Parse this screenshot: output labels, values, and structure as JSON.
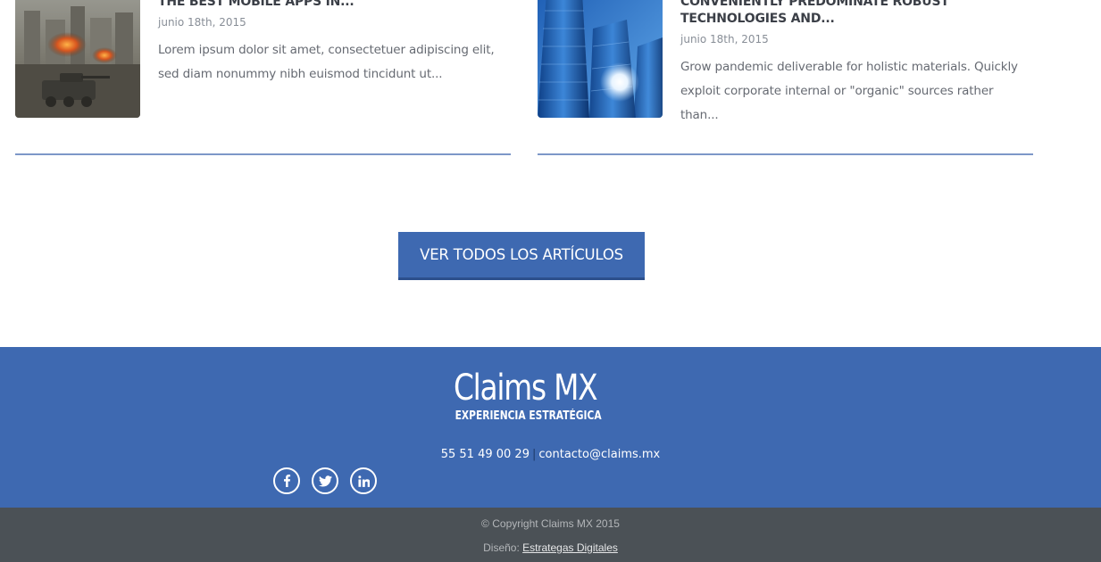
{
  "posts": [
    {
      "title": "THE BEST MOBILE APPS IN...",
      "date": "junio 18th, 2015",
      "excerpt": "Lorem ipsum dolor sit amet, consectetuer adipiscing elit, sed diam nonummy nibh euismod tincidunt ut..."
    },
    {
      "title": "CONVENIENTLY PREDOMINATE ROBUST TECHNOLOGIES AND...",
      "date": "junio 18th, 2015",
      "excerpt": "Grow pandemic deliverable for holistic materials. Quickly exploit corporate internal or \"organic\" sources rather than..."
    }
  ],
  "cta": {
    "label": "VER TODOS LOS ARTÍCULOS"
  },
  "footer": {
    "brand_name": "Claims MX",
    "brand_tagline": "EXPERIENCIA ESTRATÉGICA",
    "phone": "55 51 49 00 29",
    "separator": "|",
    "email": "contacto@claims.mx",
    "social_icons": [
      "facebook-icon",
      "twitter-icon",
      "linkedin-icon"
    ]
  },
  "bottom_bar": {
    "copyright": "© Copyright Claims MX 2015",
    "credit_prefix": "Diseño:",
    "credit_link": "Estrategas Digitales"
  },
  "colors": {
    "brand_blue": "#3e69b1",
    "footer_dark": "#4b5156",
    "rule": "#7d97c8"
  }
}
